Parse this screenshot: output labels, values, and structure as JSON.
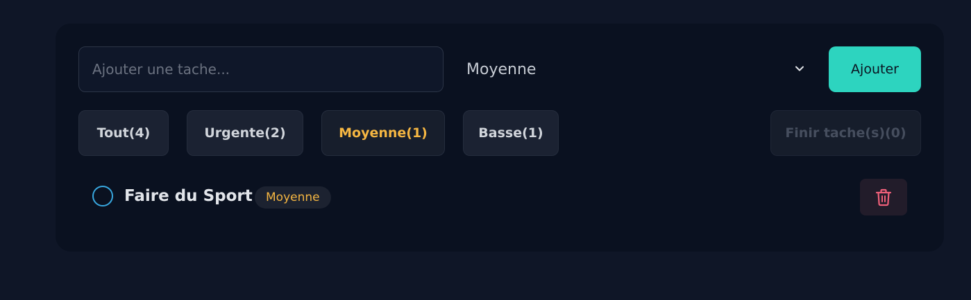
{
  "form": {
    "input_value": "",
    "input_placeholder": "Ajouter une tache...",
    "priority_selected": "Moyenne",
    "add_label": "Ajouter"
  },
  "filters": [
    {
      "label": "Tout(4)",
      "active": false
    },
    {
      "label": "Urgente(2)",
      "active": false
    },
    {
      "label": "Moyenne(1)",
      "active": true
    },
    {
      "label": "Basse(1)",
      "active": false
    }
  ],
  "finish_label": "Finir tache(s)(0)",
  "tasks": [
    {
      "title": "Faire du Sport",
      "priority": "Moyenne",
      "done": false
    }
  ],
  "colors": {
    "background": "#0f1627",
    "panel": "#0a1120",
    "accent": "#2dd4bf",
    "active_filter": "#f5b642",
    "checkbox": "#38a8e0",
    "delete": "#f0607a"
  },
  "icons": {
    "select_arrow": "chevron-down-icon",
    "delete": "trash-icon"
  }
}
